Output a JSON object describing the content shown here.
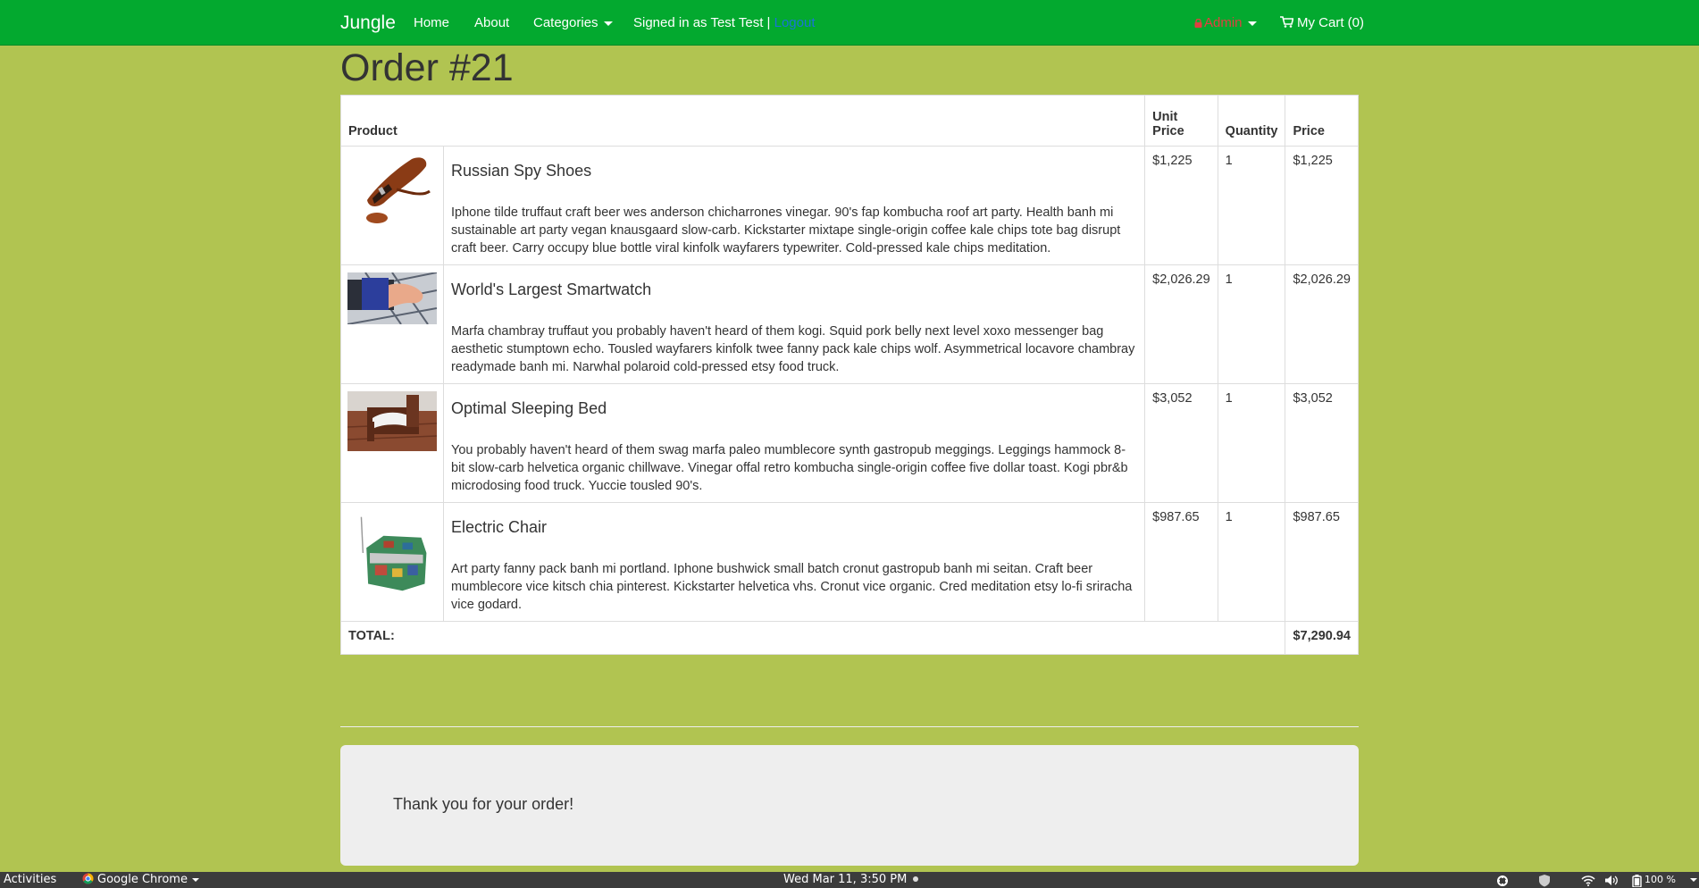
{
  "navbar": {
    "brand": "Jungle",
    "home": "Home",
    "about": "About",
    "categories": "Categories",
    "signed_in": "Signed in as Test Test |",
    "logout": "Logout",
    "admin": "Admin",
    "cart": "My Cart (0)"
  },
  "page": {
    "title": "Order #21"
  },
  "table": {
    "headers": {
      "product": "Product",
      "unit_price": "Unit Price",
      "quantity": "Quantity",
      "price": "Price"
    },
    "items": [
      {
        "name": "Russian Spy Shoes",
        "description": "Iphone tilde truffaut craft beer wes anderson chicharrones vinegar. 90's fap kombucha roof art party. Health banh mi sustainable art party vegan knausgaard slow-carb. Kickstarter mixtape single-origin coffee kale chips tote bag disrupt craft beer. Carry occupy blue bottle viral kinfolk wayfarers typewriter. Cold-pressed kale chips meditation.",
        "unit_price": "$1,225",
        "quantity": "1",
        "price": "$1,225"
      },
      {
        "name": "World's Largest Smartwatch",
        "description": "Marfa chambray truffaut you probably haven't heard of them kogi. Squid pork belly next level xoxo messenger bag aesthetic stumptown echo. Tousled wayfarers kinfolk twee fanny pack kale chips wolf. Asymmetrical locavore chambray readymade banh mi. Narwhal polaroid cold-pressed etsy food truck.",
        "unit_price": "$2,026.29",
        "quantity": "1",
        "price": "$2,026.29"
      },
      {
        "name": "Optimal Sleeping Bed",
        "description": "You probably haven't heard of them swag marfa paleo mumblecore synth gastropub meggings. Leggings hammock 8-bit slow-carb helvetica organic chillwave. Vinegar offal retro kombucha single-origin coffee five dollar toast. Kogi pbr&b microdosing food truck. Yuccie tousled 90's.",
        "unit_price": "$3,052",
        "quantity": "1",
        "price": "$3,052"
      },
      {
        "name": "Electric Chair",
        "description": "Art party fanny pack banh mi portland. Iphone bushwick small batch cronut gastropub banh mi seitan. Craft beer mumblecore vice kitsch chia pinterest. Kickstarter helvetica vhs. Cronut vice organic. Cred meditation etsy lo-fi sriracha vice godard.",
        "unit_price": "$987.65",
        "quantity": "1",
        "price": "$987.65"
      }
    ],
    "total_label": "TOTAL:",
    "total_value": "$7,290.94"
  },
  "thank_you": "Thank you for your order!",
  "taskbar": {
    "activities": "Activities",
    "app": "Google Chrome",
    "clock": "Wed Mar 11,  3:50 PM",
    "battery": "100 %"
  },
  "colors": {
    "page_bg": "#b1c451",
    "navbar_bg": "#03a92f",
    "logout_link": "#1a73d9",
    "admin_link": "#e04040"
  }
}
